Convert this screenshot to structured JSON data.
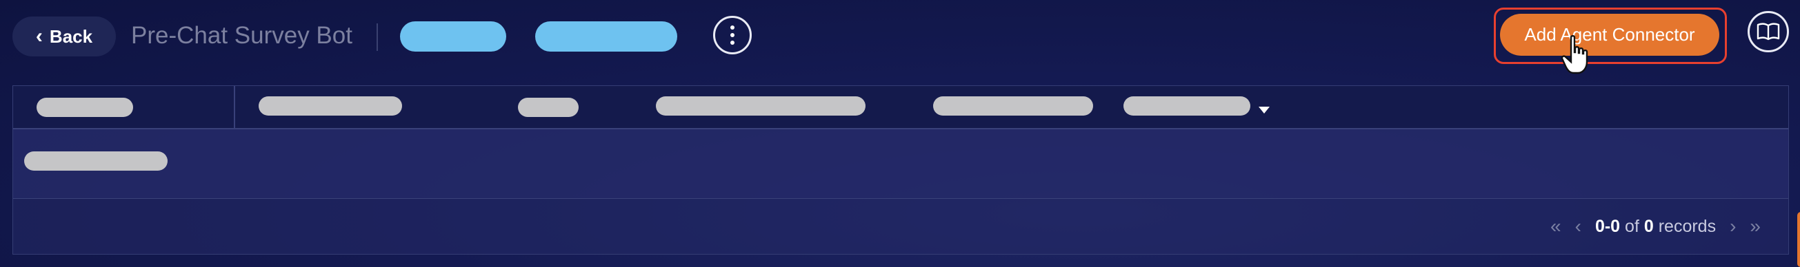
{
  "header": {
    "back_label": "Back",
    "title": "Pre-Chat Survey Bot",
    "primary_action_label": "Add Agent Connector"
  },
  "pagination": {
    "range": "0-0",
    "of_label": "of",
    "total": "0",
    "records_label": "records",
    "first_icon": "«",
    "prev_icon": "‹",
    "next_icon": "›",
    "last_icon": "»"
  },
  "icons": {
    "back": "chevron-left-icon",
    "more": "more-vertical-icon",
    "docs": "book-icon",
    "cursor": "hand-pointer-icon",
    "sort": "caret-down-icon"
  },
  "colors": {
    "background": "#141a52",
    "accent_blue": "#6ec2f0",
    "cta_orange": "#e5762e",
    "focus_outline": "#e8402f",
    "skeleton": "#c5c5c7"
  }
}
